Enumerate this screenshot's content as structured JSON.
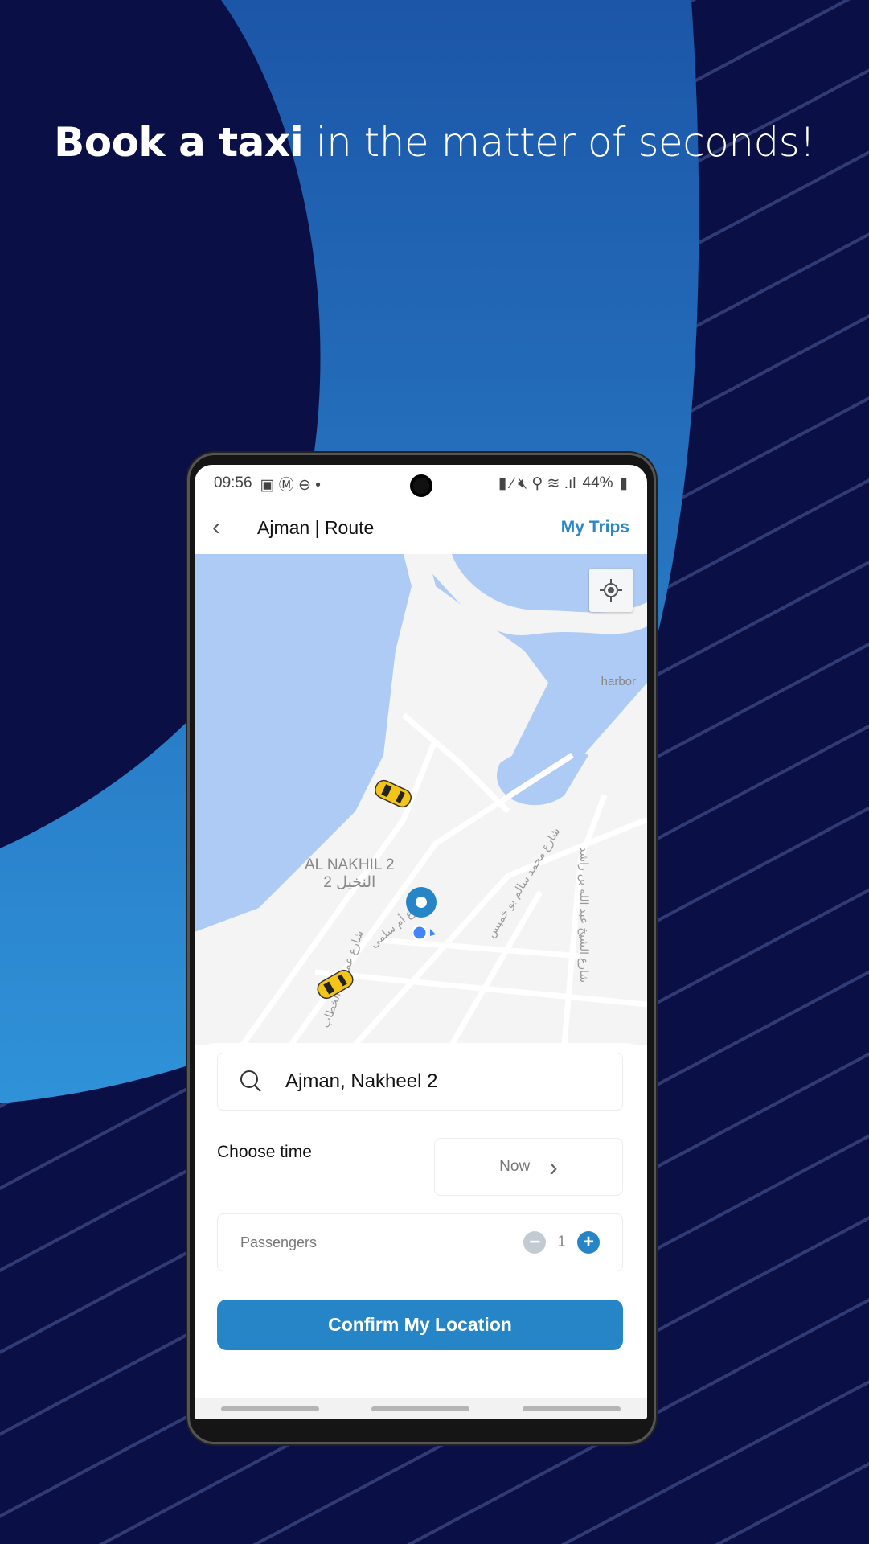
{
  "headline": {
    "bold": "Book a taxi",
    "rest": " in the matter of seconds!"
  },
  "colors": {
    "background": "#0a1045",
    "accent": "#2585c7",
    "map_water": "#aecbf5"
  },
  "status_bar": {
    "time": "09:56",
    "battery": "44%",
    "icons": [
      "image-icon",
      "gmail-icon",
      "dnd-icon",
      "dot-icon",
      "battery-saver-icon",
      "pen-icon",
      "mute-icon",
      "location-icon",
      "wifi-icon",
      "signal-icon",
      "battery-icon"
    ]
  },
  "header": {
    "back_icon": "chevron-left-icon",
    "title": "Ajman | Route",
    "my_trips": "My Trips"
  },
  "map": {
    "district_en": "AL NAKHIL 2",
    "district_ar": "النخيل 2",
    "harbor": "harbor",
    "streets": [
      "شارع محمد سالم بو خميس",
      "شارع الشيخ عبد الله بن راشد",
      "شارع أم سلمى",
      "شارع عمر بن الخطاب"
    ],
    "locate_icon": "crosshair-icon"
  },
  "form": {
    "search_value": "Ajman, Nakheel 2",
    "choose_time_label": "Choose time",
    "time_value": "Now",
    "passengers_label": "Passengers",
    "passengers_count": "1",
    "confirm_label": "Confirm My Location"
  }
}
